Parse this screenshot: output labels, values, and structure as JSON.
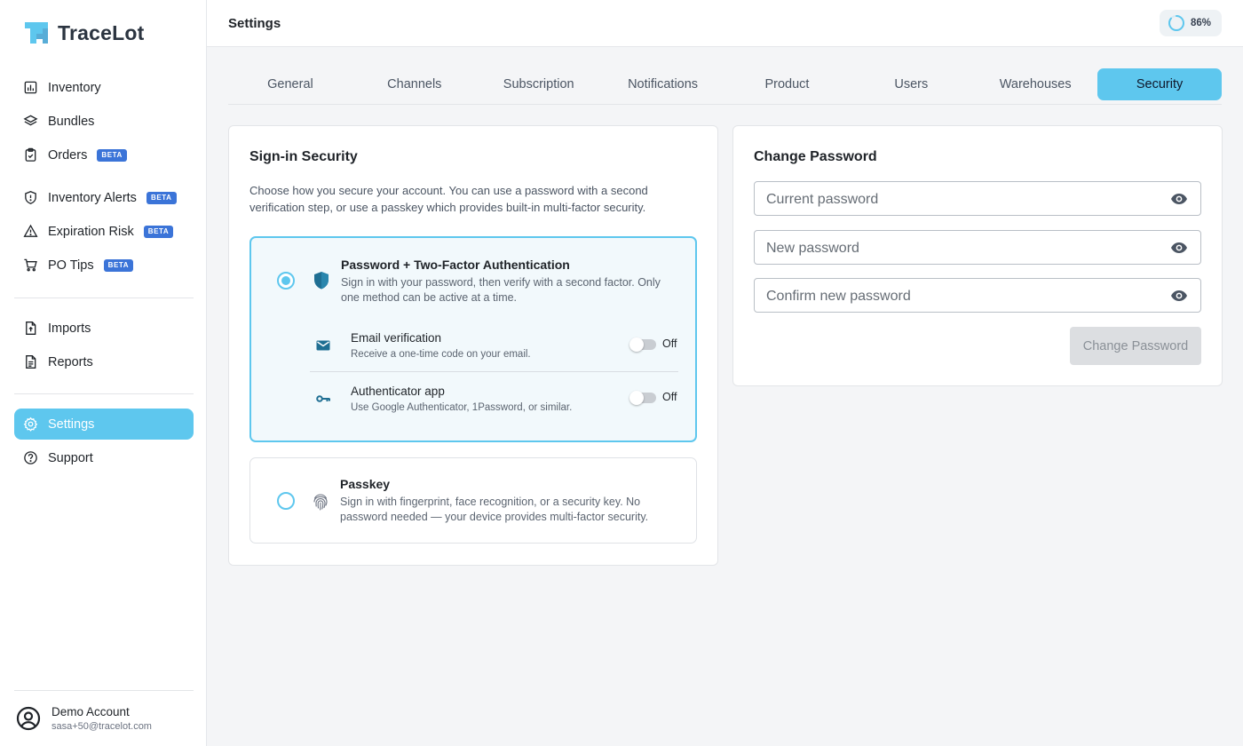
{
  "brand": {
    "name": "TraceLot"
  },
  "colors": {
    "accent": "#5ec7ee",
    "badge": "#3b74d8",
    "shield": "#1f6f93"
  },
  "sidebar": {
    "items": [
      {
        "label": "Inventory",
        "icon": "inventory-icon"
      },
      {
        "label": "Bundles",
        "icon": "layers-icon"
      },
      {
        "label": "Orders",
        "icon": "clipboard-icon",
        "badge": "BETA"
      },
      {
        "label": "Inventory Alerts",
        "icon": "shield-alert-icon",
        "badge": "BETA"
      },
      {
        "label": "Expiration Risk",
        "icon": "warning-icon",
        "badge": "BETA"
      },
      {
        "label": "PO Tips",
        "icon": "cart-icon",
        "badge": "BETA"
      },
      {
        "label": "Imports",
        "icon": "file-import-icon"
      },
      {
        "label": "Reports",
        "icon": "file-report-icon"
      },
      {
        "label": "Settings",
        "icon": "gear-icon",
        "active": true
      },
      {
        "label": "Support",
        "icon": "help-icon"
      }
    ]
  },
  "account": {
    "name": "Demo Account",
    "email": "sasa+50@tracelot.com"
  },
  "header": {
    "title": "Settings",
    "progress_label": "86%",
    "progress_value": 0.86
  },
  "tabs": [
    "General",
    "Channels",
    "Subscription",
    "Notifications",
    "Product",
    "Users",
    "Warehouses",
    "Security"
  ],
  "active_tab": "Security",
  "signin": {
    "title": "Sign-in Security",
    "description": "Choose how you secure your account. You can use a password with a second verification step, or use a passkey which provides built-in multi-factor security.",
    "options": {
      "twofa": {
        "title": "Password + Two-Factor Authentication",
        "description": "Sign in with your password, then verify with a second factor. Only one method can be active at a time.",
        "selected": true,
        "methods": [
          {
            "title": "Email verification",
            "description": "Receive a one-time code on your email.",
            "state": "Off"
          },
          {
            "title": "Authenticator app",
            "description": "Use Google Authenticator, 1Password, or similar.",
            "state": "Off"
          }
        ]
      },
      "passkey": {
        "title": "Passkey",
        "description": "Sign in with fingerprint, face recognition, or a security key. No password needed — your device provides multi-factor security.",
        "selected": false
      }
    }
  },
  "password": {
    "title": "Change Password",
    "current_placeholder": "Current password",
    "new_placeholder": "New password",
    "confirm_placeholder": "Confirm new password",
    "button": "Change Password"
  }
}
